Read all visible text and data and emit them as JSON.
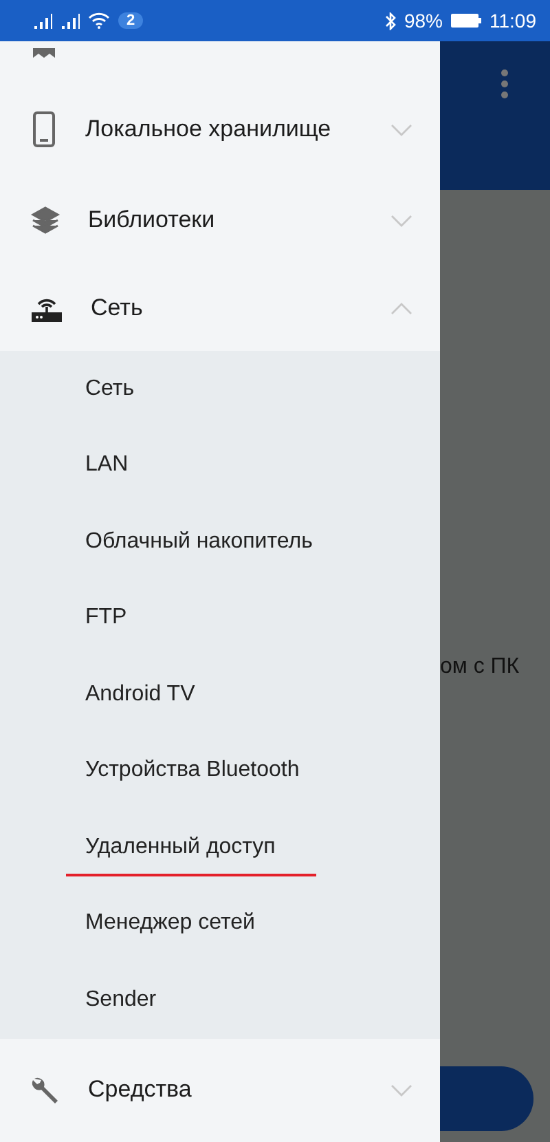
{
  "status_bar": {
    "notification_count": "2",
    "battery": "98%",
    "time": "11:09"
  },
  "drawer": {
    "items": [
      {
        "label": "Локальное хранилище",
        "kind": "phone",
        "expanded": false
      },
      {
        "label": "Библиотеки",
        "kind": "layers",
        "expanded": false
      },
      {
        "label": "Сеть",
        "kind": "router",
        "expanded": true,
        "children": [
          {
            "label": "Сеть",
            "underlined": false
          },
          {
            "label": "LAN",
            "underlined": false
          },
          {
            "label": "Облачный накопитель",
            "underlined": false
          },
          {
            "label": "FTP",
            "underlined": false
          },
          {
            "label": "Android TV",
            "underlined": false
          },
          {
            "label": "Устройства Bluetooth",
            "underlined": false
          },
          {
            "label": "Удаленный доступ",
            "underlined": true
          },
          {
            "label": "Менеджер сетей",
            "underlined": false
          },
          {
            "label": "Sender",
            "underlined": false
          }
        ]
      },
      {
        "label": "Средства",
        "kind": "wrench",
        "expanded": false
      }
    ]
  },
  "background": {
    "text": "ом с ПК"
  }
}
